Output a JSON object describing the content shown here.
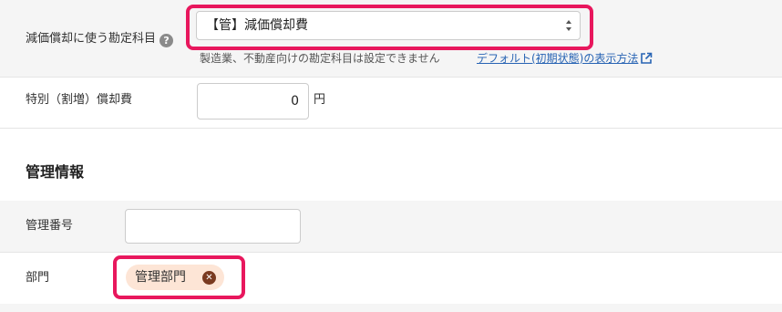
{
  "depreciation_account": {
    "label": "減価償却に使う勘定科目",
    "help_icon": "question-circle-icon",
    "selected_value": "【管】減価償却費",
    "note": "製造業、不動産向けの勘定科目は設定できません",
    "link_text": "デフォルト(初期状態)の表示方法",
    "link_icon": "external-link-icon",
    "link_color": "#2864b4"
  },
  "special_depreciation": {
    "label": "特別（割増）償却費",
    "value": "0",
    "unit": "円"
  },
  "management": {
    "section_title": "管理情報",
    "number_label": "管理番号",
    "number_value": "",
    "department_label": "部門",
    "department_tag": "管理部門",
    "tag_remove_icon": "close-circle-icon"
  },
  "colors": {
    "highlight": "#e8175d",
    "tag_background": "#fde5d6",
    "row_background": "#f5f5f5"
  }
}
